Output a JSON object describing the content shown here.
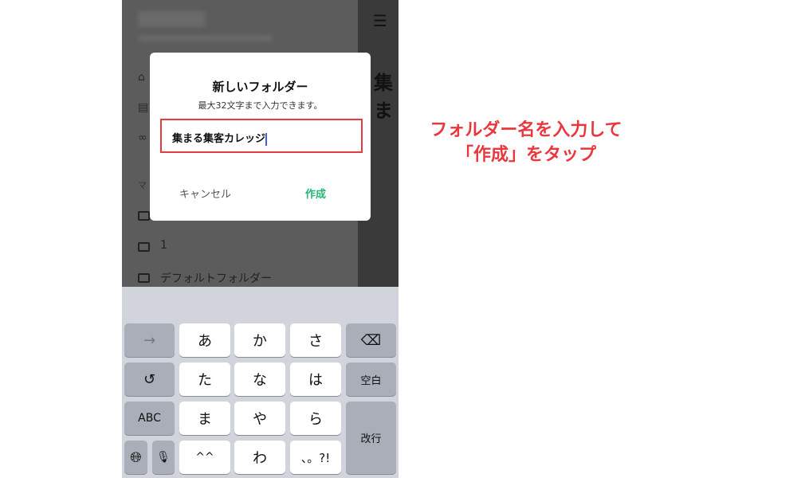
{
  "sidebar": {
    "folders": [
      "1",
      "デフォルトフォルダー"
    ],
    "section_initial": "マ"
  },
  "header": {
    "menu_icon": "hamburger-icon",
    "page_title_partial": "集ま"
  },
  "dialog": {
    "title": "新しいフォルダー",
    "subtitle": "最大32文字まで入力できます。",
    "input_value": "集まる集客カレッジ",
    "cancel_label": "キャンセル",
    "create_label": "作成",
    "create_color": "#25b574",
    "highlight_color": "#e53a3f"
  },
  "keyboard": {
    "rows": [
      [
        "あ",
        "か",
        "さ"
      ],
      [
        "た",
        "な",
        "は"
      ],
      [
        "ま",
        "や",
        "ら"
      ],
      [
        "^^",
        "わ",
        "、。?!"
      ]
    ],
    "arrow": "→",
    "undo": "↺",
    "abc": "ABC",
    "space": "空白",
    "enter": "改行"
  },
  "annotation": {
    "line1": "フォルダー名を入力して",
    "line2": "「作成」をタップ",
    "color": "#e8383d"
  }
}
